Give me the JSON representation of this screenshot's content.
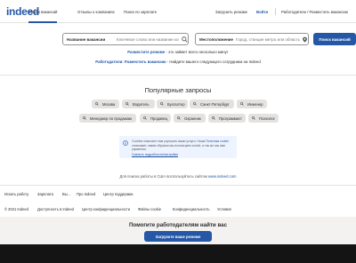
{
  "brand": {
    "logo_text": "indeed",
    "primary_color": "#2557a7",
    "divider_color": "#e4e2e0",
    "chip_color": "#e4e2e0",
    "cookie_bg": "#edf4ff",
    "footer_bg": "#f3f2f1",
    "black_bar": "#141414"
  },
  "topnav": {
    "links": [
      "Поиск вакансий",
      "Отзывы о компаниях",
      "Поиск по зарплате"
    ],
    "upload_resume": "Загрузить резюме",
    "login": "Войти",
    "employers": "Работодатели / Разместить вакансию"
  },
  "search": {
    "what_label": "Название вакансии",
    "what_placeholder": "Ключевое слово или название компании",
    "what_icon": "search-icon",
    "where_label": "Местоположение",
    "where_placeholder": "Город, станция метро или область",
    "where_icon": "location-pin-icon",
    "button": "Поиск вакансий"
  },
  "promo": {
    "resume_link": "Разместите резюме",
    "resume_text": " - это займет всего несколько минут",
    "employer_link": "Работодатели: Разместить вакансию",
    "employer_text": " - Найдите вашего следующего сотрудника на Indeed"
  },
  "popular": {
    "title": "Популярные запросы",
    "chips": [
      "Москва",
      "Водитель",
      "Бухгалтер",
      "Санкт-Петербург",
      "Инженер",
      "Менеджер по продажам",
      "Продавец",
      "Охранник",
      "Программист",
      "Психолог"
    ]
  },
  "cookie": {
    "text_before": "Cookies помогают нам улучшить ваши услуги. Наша ",
    "policy_link": "Политика cookie",
    "text_after": " описывает, каким образом мы используем cookie, а так же как ими управлять.",
    "settings_link": "Сменить подробности/настройки",
    "icon": "info-icon"
  },
  "usa_note": {
    "text": "Для поиска работы в США воспользуйтесь сайтом ",
    "link": "www.indeed.com"
  },
  "footer": {
    "row1": [
      "Искать работу",
      "Зарплата",
      "Вы…",
      "Про Indeed",
      "Центр поддержки"
    ],
    "row2": [
      "© 2021 Indeed",
      "Доступность в Indeed",
      "Центр конфиденциальности",
      "Файлы cookie",
      "Конфиденциальность",
      "Условия"
    ]
  },
  "bottom_banner": {
    "title": "Помогите работодателям найти вас",
    "button": "Загрузите ваше резюме"
  }
}
